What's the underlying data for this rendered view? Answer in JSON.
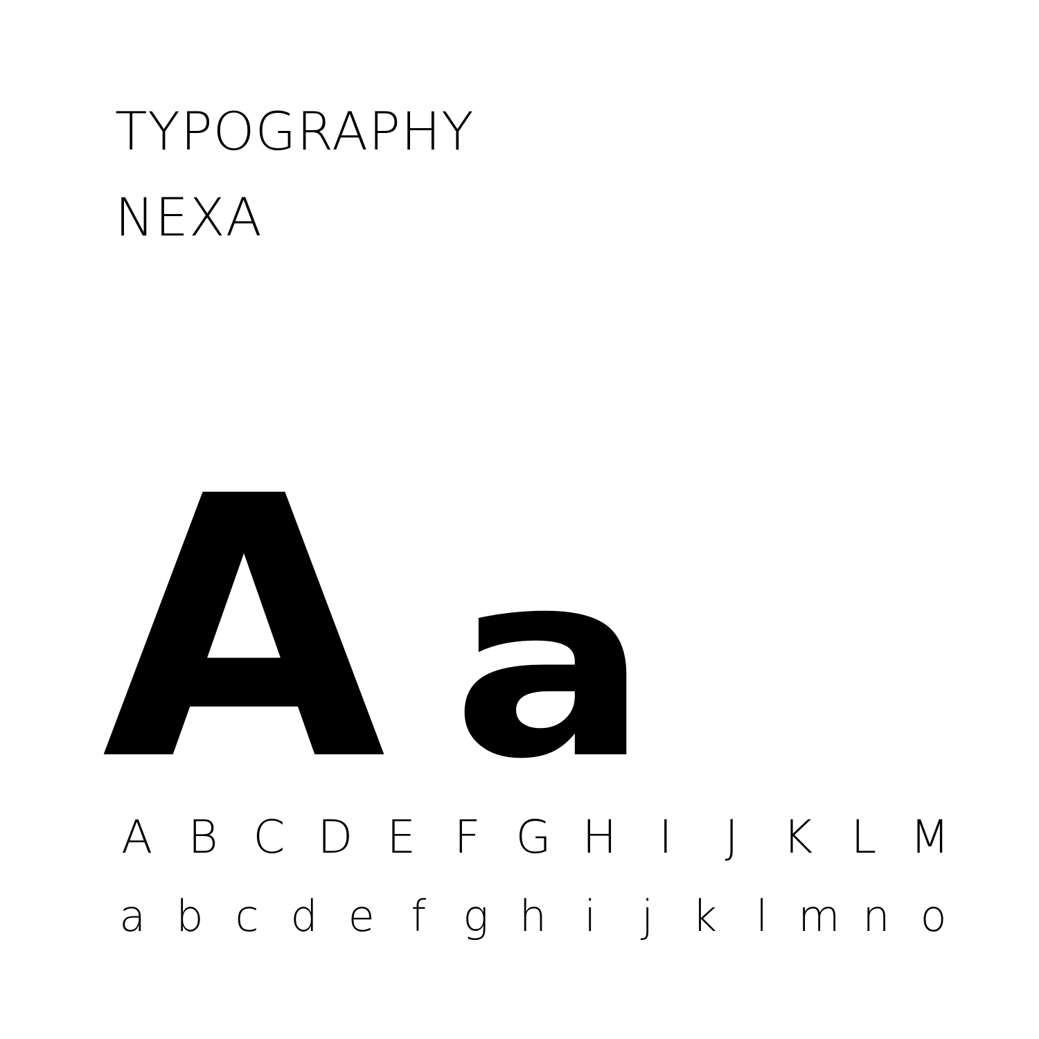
{
  "title": "TYPOGRAPHY",
  "subtitle": "NEXA",
  "specimen": {
    "upper": "A",
    "lower": "a"
  },
  "uppercase": [
    "A",
    "B",
    "C",
    "D",
    "E",
    "F",
    "G",
    "H",
    "I",
    "J",
    "K",
    "L",
    "M"
  ],
  "lowercase": [
    "a",
    "b",
    "c",
    "d",
    "e",
    "f",
    "g",
    "h",
    "i",
    "j",
    "k",
    "l",
    "m",
    "n",
    "o"
  ],
  "colors": {
    "background": "#ffffff",
    "text": "#000000"
  }
}
